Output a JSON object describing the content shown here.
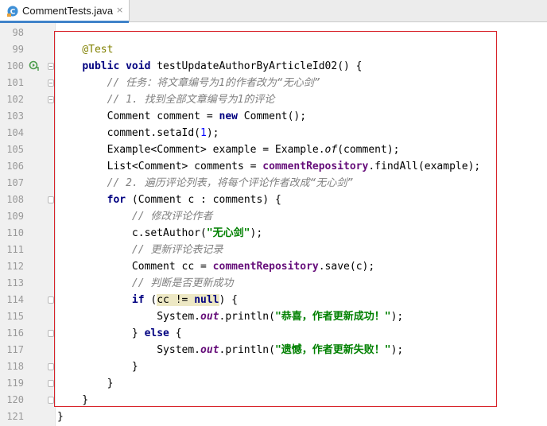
{
  "tab": {
    "title": "CommentTests.java",
    "close": "×",
    "icon": "java-class-icon"
  },
  "lines": [
    {
      "num": "98",
      "tokens": []
    },
    {
      "num": "99",
      "tokens": [
        {
          "t": "    @Test",
          "c": "ann"
        }
      ]
    },
    {
      "num": "100",
      "tokens": [
        {
          "t": "    "
        },
        {
          "t": "public void",
          "c": "kw"
        },
        {
          "t": " testUpdateAuthorByArticleId02() {"
        }
      ]
    },
    {
      "num": "101",
      "tokens": [
        {
          "t": "        "
        },
        {
          "t": "// 任务：将文章编号为1的作者改为“无心剑”",
          "c": "cm"
        }
      ]
    },
    {
      "num": "102",
      "tokens": [
        {
          "t": "        "
        },
        {
          "t": "// 1. 找到全部文章编号为1的评论",
          "c": "cm"
        }
      ]
    },
    {
      "num": "103",
      "tokens": [
        {
          "t": "        Comment comment = "
        },
        {
          "t": "new",
          "c": "kw"
        },
        {
          "t": " Comment();"
        }
      ]
    },
    {
      "num": "104",
      "tokens": [
        {
          "t": "        comment.setaId("
        },
        {
          "t": "1",
          "c": "num"
        },
        {
          "t": ");"
        }
      ]
    },
    {
      "num": "105",
      "tokens": [
        {
          "t": "        Example<Comment> example = Example."
        },
        {
          "t": "of",
          "c": "smeth"
        },
        {
          "t": "(comment);"
        }
      ]
    },
    {
      "num": "106",
      "tokens": [
        {
          "t": "        List<Comment> comments = "
        },
        {
          "t": "commentRepository",
          "c": "fld"
        },
        {
          "t": ".findAll(example);"
        }
      ]
    },
    {
      "num": "107",
      "tokens": [
        {
          "t": "        "
        },
        {
          "t": "// 2. 遍历评论列表，将每个评论作者改成“无心剑”",
          "c": "cm"
        }
      ]
    },
    {
      "num": "108",
      "tokens": [
        {
          "t": "        "
        },
        {
          "t": "for",
          "c": "kw"
        },
        {
          "t": " (Comment c : comments) {"
        }
      ]
    },
    {
      "num": "109",
      "tokens": [
        {
          "t": "            "
        },
        {
          "t": "// 修改评论作者",
          "c": "cm"
        }
      ]
    },
    {
      "num": "110",
      "tokens": [
        {
          "t": "            c.setAuthor("
        },
        {
          "t": "\"无心剑\"",
          "c": "str"
        },
        {
          "t": ");"
        }
      ]
    },
    {
      "num": "111",
      "tokens": [
        {
          "t": "            "
        },
        {
          "t": "// 更新评论表记录",
          "c": "cm"
        }
      ]
    },
    {
      "num": "112",
      "tokens": [
        {
          "t": "            Comment cc = "
        },
        {
          "t": "commentRepository",
          "c": "fld"
        },
        {
          "t": ".save(c);"
        }
      ]
    },
    {
      "num": "113",
      "tokens": [
        {
          "t": "            "
        },
        {
          "t": "// 判断是否更新成功",
          "c": "cm"
        }
      ]
    },
    {
      "num": "114",
      "tokens": [
        {
          "t": "            "
        },
        {
          "t": "if",
          "c": "kw"
        },
        {
          "t": " ("
        },
        {
          "t": "cc != ",
          "c": "hl"
        },
        {
          "t": "null",
          "c": "kw hl"
        },
        {
          "t": ") {"
        }
      ]
    },
    {
      "num": "115",
      "tokens": [
        {
          "t": "                System."
        },
        {
          "t": "out",
          "c": "sfld"
        },
        {
          "t": ".println("
        },
        {
          "t": "\"恭喜，作者更新成功！\"",
          "c": "str"
        },
        {
          "t": ");"
        }
      ]
    },
    {
      "num": "116",
      "tokens": [
        {
          "t": "            } "
        },
        {
          "t": "else",
          "c": "kw"
        },
        {
          "t": " {"
        }
      ]
    },
    {
      "num": "117",
      "tokens": [
        {
          "t": "                System."
        },
        {
          "t": "out",
          "c": "sfld"
        },
        {
          "t": ".println("
        },
        {
          "t": "\"遗憾，作者更新失败！\"",
          "c": "str"
        },
        {
          "t": ");"
        }
      ]
    },
    {
      "num": "118",
      "tokens": [
        {
          "t": "            }"
        }
      ]
    },
    {
      "num": "119",
      "tokens": [
        {
          "t": "        }"
        }
      ]
    },
    {
      "num": "120",
      "tokens": [
        {
          "t": "    }"
        }
      ]
    },
    {
      "num": "121",
      "tokens": [
        {
          "t": "}"
        }
      ]
    }
  ],
  "gutter_icons": {
    "run": "run-test-icon",
    "fold": "fold-marker-icon"
  },
  "colors": {
    "keyword": "#000080",
    "comment": "#808080",
    "string": "#008000",
    "field": "#660e7a",
    "annotation": "#808000",
    "highlight_border": "#d8232a"
  }
}
